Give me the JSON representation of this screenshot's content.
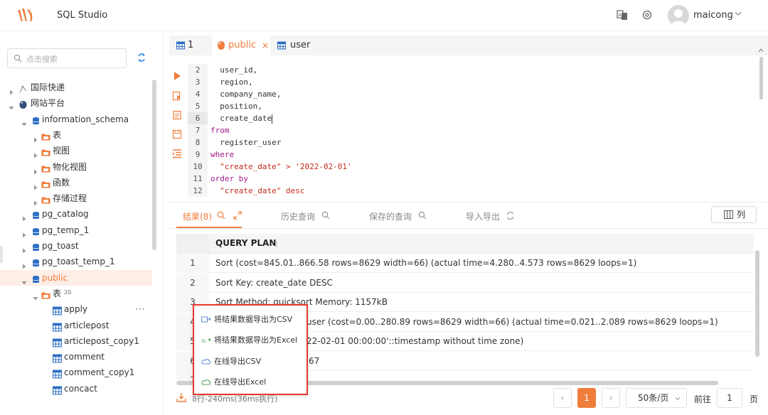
{
  "app": {
    "title": "SQL Studio",
    "user": "maicong",
    "accent": "#ef7d3c"
  },
  "sidebar": {
    "search_placeholder": "点击搜索",
    "tree": [
      {
        "label": "国际快递",
        "level": 0,
        "icon": "connection-icon"
      },
      {
        "label": "网站平台",
        "level": 0,
        "icon": "postgres-icon"
      },
      {
        "label": "information_schema",
        "level": 1,
        "icon": "database-icon"
      },
      {
        "label": "表",
        "level": 2,
        "icon": "folder-table-icon"
      },
      {
        "label": "视图",
        "level": 2,
        "icon": "folder-view-icon"
      },
      {
        "label": "物化视图",
        "level": 2,
        "icon": "folder-mview-icon"
      },
      {
        "label": "函数",
        "level": 2,
        "icon": "folder-function-icon"
      },
      {
        "label": "存储过程",
        "level": 2,
        "icon": "folder-procedure-icon"
      },
      {
        "label": "pg_catalog",
        "level": 1,
        "icon": "database-icon"
      },
      {
        "label": "pg_temp_1",
        "level": 1,
        "icon": "database-icon"
      },
      {
        "label": "pg_toast",
        "level": 1,
        "icon": "database-icon"
      },
      {
        "label": "pg_toast_temp_1",
        "level": 1,
        "icon": "database-icon"
      },
      {
        "label": "public",
        "level": 1,
        "icon": "database-icon",
        "selected": true
      },
      {
        "label": "表",
        "level": 2,
        "icon": "folder-table-icon",
        "badge": "20"
      },
      {
        "label": "apply",
        "level": 3,
        "icon": "table-icon"
      },
      {
        "label": "articlepost",
        "level": 3,
        "icon": "table-icon"
      },
      {
        "label": "articlepost_copy1",
        "level": 3,
        "icon": "table-icon"
      },
      {
        "label": "comment",
        "level": 3,
        "icon": "table-icon"
      },
      {
        "label": "comment_copy1",
        "level": 3,
        "icon": "table-icon"
      },
      {
        "label": "concact",
        "level": 3,
        "icon": "table-icon"
      }
    ]
  },
  "editor_tabs": [
    {
      "label": "1",
      "icon": "table-icon"
    },
    {
      "label": "public",
      "icon": "postgres-icon",
      "active": true,
      "close": "×"
    },
    {
      "label": "user",
      "icon": "table-icon"
    }
  ],
  "editor": {
    "lines": [
      {
        "n": "2",
        "text": "  user_id,"
      },
      {
        "n": "3",
        "text": "  region,"
      },
      {
        "n": "4",
        "text": "  company_name,"
      },
      {
        "n": "5",
        "text": "  position,"
      },
      {
        "n": "6",
        "text": "  create_date"
      },
      {
        "n": "7",
        "text": "from"
      },
      {
        "n": "8",
        "text": "  register_user"
      },
      {
        "n": "9",
        "text": "where"
      },
      {
        "n": "10",
        "text": "  \"create_date\" > '2022-02-01'"
      },
      {
        "n": "11",
        "text": "order by"
      },
      {
        "n": "12",
        "text": "  \"create_date\" desc"
      }
    ]
  },
  "result_tabs": {
    "results": "结果(8)",
    "history": "历史查询",
    "saved": "保存的查询",
    "import_export": "导入导出",
    "columns": "列"
  },
  "result_grid": {
    "header": "QUERY PLAN",
    "rows": [
      {
        "n": "1",
        "v": "Sort (cost=845.01..866.58 rows=8629 width=66) (actual time=4.280..4.573 rows=8629 loops=1)"
      },
      {
        "n": "2",
        "v": "Sort Key: create_date DESC"
      },
      {
        "n": "3",
        "v": "Sort Method: quicksort Memory: 1157kB"
      },
      {
        "n": "4",
        "v": "user (cost=0.00..280.89 rows=8629 width=66) (actual time=0.021..2.089 rows=8629 loops=1)"
      },
      {
        "n": "5",
        "v": "22-02-01 00:00:00'::timestamp without time zone)"
      },
      {
        "n": "6",
        "v": "67"
      },
      {
        "n": "7",
        "v": ""
      }
    ]
  },
  "context_menu": {
    "items": [
      "将结果数据导出为CSV",
      "将结果数据导出为Excel",
      "在线导出CSV",
      "在线导出Excel"
    ]
  },
  "footer": {
    "status": "8行-240ms(36ms执行)",
    "prev": "‹",
    "page": "1",
    "next": "›",
    "page_size": "50条/页",
    "goto_label": "前往",
    "goto_value": "1",
    "goto_unit": "页"
  }
}
